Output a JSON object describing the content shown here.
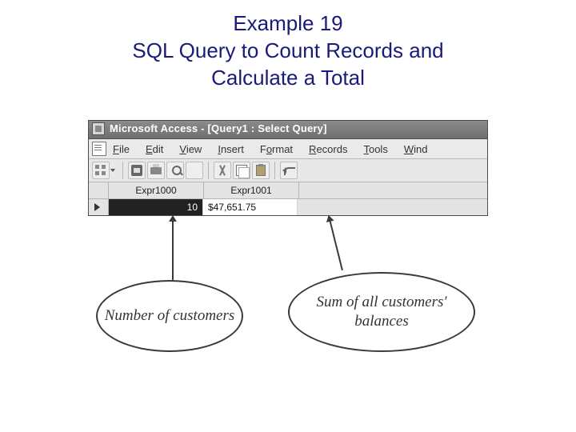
{
  "title": {
    "line1": "Example 19",
    "line2": "SQL Query to Count Records and",
    "line3": "Calculate a Total"
  },
  "window": {
    "titlebar": "Microsoft Access - [Query1 : Select Query]"
  },
  "menu": {
    "file": "File",
    "edit": "Edit",
    "view": "View",
    "insert": "Insert",
    "format": "Format",
    "records": "Records",
    "tools": "Tools",
    "window": "Wind"
  },
  "grid": {
    "col1": "Expr1000",
    "col2": "Expr1001",
    "val1": "10",
    "val2": "$47,651.75"
  },
  "annotations": {
    "left": "Number of customers",
    "right": "Sum of all customers' balances"
  }
}
